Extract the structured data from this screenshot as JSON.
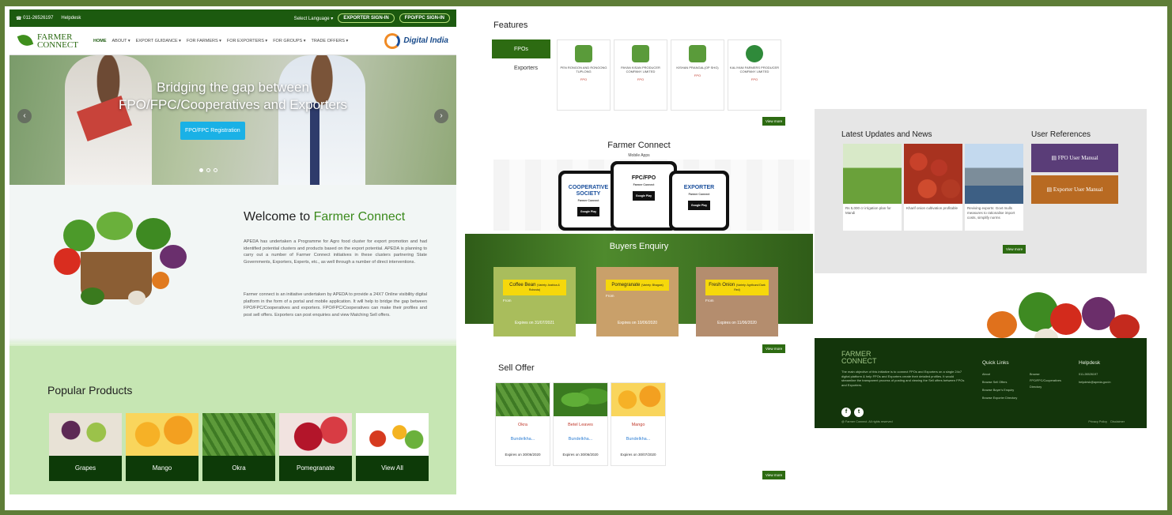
{
  "topbar": {
    "phone": "011-26526197",
    "helpdesk": "Helpdesk",
    "language": "Select Language ▾",
    "exporter_signin": "EXPORTER SIGN-IN",
    "fpo_signin": "FPO/FPC SIGN-IN"
  },
  "nav": {
    "logo_line1": "FARMER",
    "logo_line2": "CONNECT",
    "items": [
      "HOME",
      "ABOUT ▾",
      "EXPORT GUIDANCE ▾",
      "FOR FARMERS ▾",
      "FOR EXPORTERS ▾",
      "FOR GROUPS ▾",
      "TRADE OFFERS ▾"
    ],
    "digital_india": "Digital India"
  },
  "hero": {
    "headline_1": "Bridging the gap between",
    "headline_2": "FPO/FPC/Cooperatives and Exporters",
    "cta": "FPO/FPC Registration",
    "prev": "‹",
    "next": "›"
  },
  "welcome": {
    "title_prefix": "Welcome to ",
    "title_accent": "Farmer Connect",
    "para1": "APEDA has undertaken a Programme for Agro food cluster for export promotion and had identified potential clusters and products based on the export potential. APEDA is planning to carry out a number of Farmer Connect initiatives in these clusters partnering State Governments, Exporters, Experts, etc., as well through a number of direct interventions.",
    "para2": "Farmer connect is an initiative undertaken by APEDA to provide a 24X7 Online visibility digital platform in the form of a portal and mobile application. It will help to bridge the gap between FPO/FPC/Cooperatives and exporters. FPO/FPC/Cooperatives can make their profiles and post sell offers. Exporters can post enquiries and view Matching Sell offers."
  },
  "popular": {
    "title": "Popular Products",
    "items": [
      "Grapes",
      "Mango",
      "Okra",
      "Pomegranate",
      "View All"
    ]
  },
  "features": {
    "title": "Features",
    "tabs": [
      "FPOs",
      "Exporters"
    ],
    "cards": [
      {
        "name": "PEN RONGON AND RONGONG TUPLONG",
        "tag": "FPO"
      },
      {
        "name": "PAYAN KISAN PRODUCER COMPANY LIMITED",
        "tag": "FPO"
      },
      {
        "name": "KISHAN PRANGAL(OP SHG)",
        "tag": "FPO"
      },
      {
        "name": "KALIYANI FARMERS PRODUCER COMPANY LIMITED",
        "tag": "FPO"
      }
    ],
    "view_more": "View more"
  },
  "mobile": {
    "title": "Farmer Connect",
    "subtitle": "Mobile Apps",
    "apps": [
      "COOPERATIVE SOCIETY",
      "FPC/FPO",
      "EXPORTER"
    ],
    "app_sub": "Farmer Connect",
    "store": "Google Play"
  },
  "buyers": {
    "title": "Buyers Enquiry",
    "cards": [
      {
        "product": "Coffee Bean",
        "variety": "(Variety: Arabica & Robusta)",
        "from": "From",
        "expires": "Expires on 31/07/2021"
      },
      {
        "product": "Pomegranate",
        "variety": "(Variety: Bhagwa)",
        "from": "From",
        "expires": "Expires on 10/06/2020"
      },
      {
        "product": "Fresh Onion",
        "variety": "(Variety: Agrifound Dark Red)",
        "from": "From",
        "expires": "Expires on 11/06/2020"
      }
    ],
    "view_more": "View more"
  },
  "sell": {
    "title": "Sell Offer",
    "cards": [
      {
        "name": "Okra",
        "location": "Bundelkha...",
        "expires": "Expires on 30/06/2020"
      },
      {
        "name": "Betel Leaves",
        "location": "Bundelkha...",
        "expires": "Expires on 30/06/2020"
      },
      {
        "name": "Mango",
        "location": "Bundelkha...",
        "expires": "Expires on 30/07/2020"
      }
    ],
    "view_more": "View more"
  },
  "updates": {
    "title": "Latest Updates and News",
    "refs_title": "User References",
    "news": [
      "Rs 5,000 cr irrigation plan for Mandi",
      "Kharif onion cultivation profitable",
      "Reviving exports: Govt mulls measures to rationalise import costs, simplify norms"
    ],
    "fpo_manual": "FPO User Manual",
    "exporter_manual": "Exporter User Manual",
    "view_more": "View more"
  },
  "footer": {
    "brand_1": "FARMER",
    "brand_2": "CONNECT",
    "description": "The main objective of this initiative is to connect FPOs and Exporters on a single 24x7 digital platform & help FPOs and Exporters create their detailed profiles. It would streamline the transparent process of posting and viewing the Sell offers between FPOs and Exporters.",
    "quick_links": "Quick Links",
    "links_a": [
      "About",
      "Browse Sell Offers",
      "Browse Buyer's Enquiry",
      "Browse Exporter Directory"
    ],
    "links_b": [
      "Browse",
      "FPO/FPC/Cooperatives",
      "Directory"
    ],
    "helpdesk": "Helpdesk",
    "help_lines": [
      "011-26526197",
      "helpdesk@apeda.gov.in"
    ],
    "copyright": "@ Farmer Connect. All rights reserved",
    "privacy": "Privacy Policy",
    "disclaimer": "Disclaimer"
  },
  "colors": {
    "brand_green": "#1c5a0f",
    "accent_green": "#3b8a1c",
    "cta_blue": "#1ab1e6",
    "highlight_yellow": "#f6d80b",
    "footer_green": "#13350b"
  }
}
